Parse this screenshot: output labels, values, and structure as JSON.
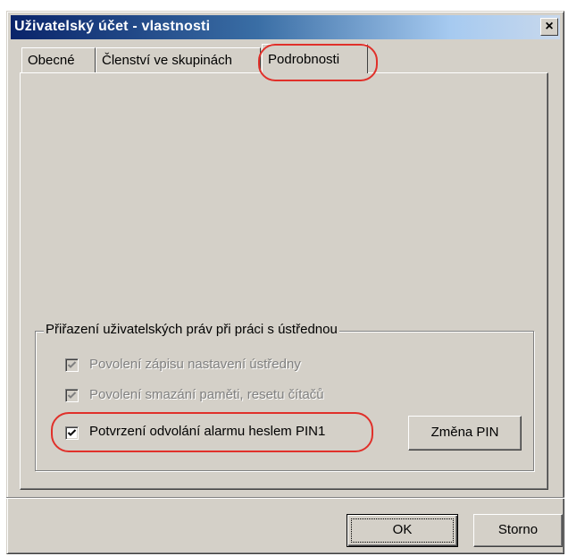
{
  "window": {
    "title": "Uživatelský účet - vlastnosti",
    "close_glyph": "×"
  },
  "tabs": [
    {
      "label": "Obecné",
      "active": false
    },
    {
      "label": "Členství ve skupinách",
      "active": false
    },
    {
      "label": "Podrobnosti",
      "active": true
    }
  ],
  "group": {
    "legend": "Přiřazení uživatelských práv při práci s ústřednou",
    "checkboxes": [
      {
        "label": "Povolení zápisu nastavení ústředny",
        "checked": true,
        "enabled": false
      },
      {
        "label": "Povolení smazání paměti, resetu čítačů",
        "checked": true,
        "enabled": false
      },
      {
        "label": "Potvrzení odvolání alarmu heslem PIN1",
        "checked": true,
        "enabled": true
      }
    ],
    "change_pin_label": "Změna PIN"
  },
  "footer": {
    "ok_label": "OK",
    "cancel_label": "Storno"
  },
  "annotations": {
    "highlight_color": "#e0302a"
  },
  "colors": {
    "dialog_face": "#d4d0c8",
    "title_active": "#0a246a",
    "disabled_text": "#808080"
  }
}
